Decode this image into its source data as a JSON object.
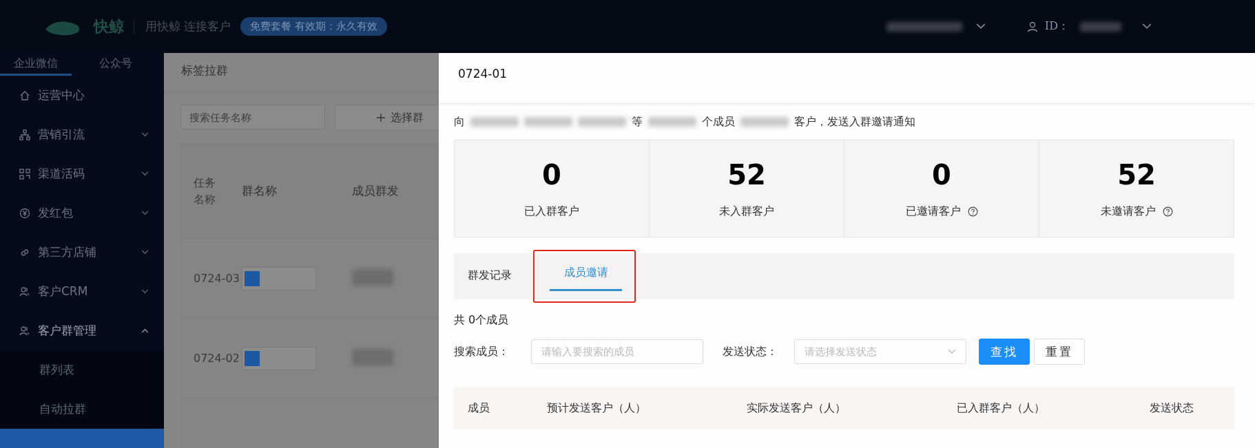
{
  "header": {
    "logo_text": "快鲸",
    "slogan": "用快鲸 连接客户",
    "plan_badge": "免费套餐  有效期：永久有效",
    "id_label": "ID："
  },
  "sidebar": {
    "tabs": [
      {
        "label": "企业微信",
        "selected": true
      },
      {
        "label": "公众号",
        "selected": false
      }
    ],
    "items": [
      {
        "label": "运营中心",
        "kind": "link",
        "expanded": false
      },
      {
        "label": "营销引流",
        "kind": "group",
        "expanded": false
      },
      {
        "label": "渠道活码",
        "kind": "group",
        "expanded": false
      },
      {
        "label": "发红包",
        "kind": "group",
        "expanded": false
      },
      {
        "label": "第三方店铺",
        "kind": "group",
        "expanded": false
      },
      {
        "label": "客户CRM",
        "kind": "group",
        "expanded": false
      },
      {
        "label": "客户群管理",
        "kind": "group",
        "expanded": true,
        "children": [
          {
            "label": "群列表",
            "selected": false
          },
          {
            "label": "自动拉群",
            "selected": false
          },
          {
            "selected": true
          }
        ]
      }
    ]
  },
  "page": {
    "title": "标签拉群",
    "search_placeholder": "搜索任务名称",
    "add_button": "选择群",
    "columns": [
      "任务名称",
      "群名称",
      "成员群发"
    ],
    "rows": [
      {
        "task": "0724-03"
      },
      {
        "task": "0724-02"
      }
    ]
  },
  "drawer": {
    "title": "0724-01",
    "intro": [
      {
        "kind": "text",
        "text": "向"
      },
      {
        "kind": "blur"
      },
      {
        "kind": "blur"
      },
      {
        "kind": "blur"
      },
      {
        "kind": "text",
        "text": "等"
      },
      {
        "kind": "blur"
      },
      {
        "kind": "text",
        "text": "个成员"
      },
      {
        "kind": "blur"
      },
      {
        "kind": "text",
        "text": "客户，发送入群邀请通知"
      }
    ],
    "stats": [
      {
        "value": "0",
        "label": "已入群客户",
        "help": false
      },
      {
        "value": "52",
        "label": "未入群客户",
        "help": false
      },
      {
        "value": "0",
        "label": "已邀请客户",
        "help": true
      },
      {
        "value": "52",
        "label": "未邀请客户",
        "help": true
      }
    ],
    "tabs": [
      {
        "label": "群发记录",
        "selected": false,
        "highlighted": false
      },
      {
        "label": "成员邀请",
        "selected": true,
        "highlighted": true
      }
    ],
    "count": "共 0个成员",
    "search": {
      "label": "搜索成员：",
      "placeholder": "请输入要搜索的成员"
    },
    "status": {
      "label": "发送状态：",
      "placeholder": "请选择发送状态"
    },
    "buttons": [
      {
        "label": "查找",
        "kind": "primary"
      },
      {
        "label": "重置",
        "kind": "default"
      }
    ],
    "columns": [
      "成员",
      "预计发送客户（人）",
      "实际发送客户（人）",
      "已入群客户（人）",
      "发送状态"
    ]
  }
}
